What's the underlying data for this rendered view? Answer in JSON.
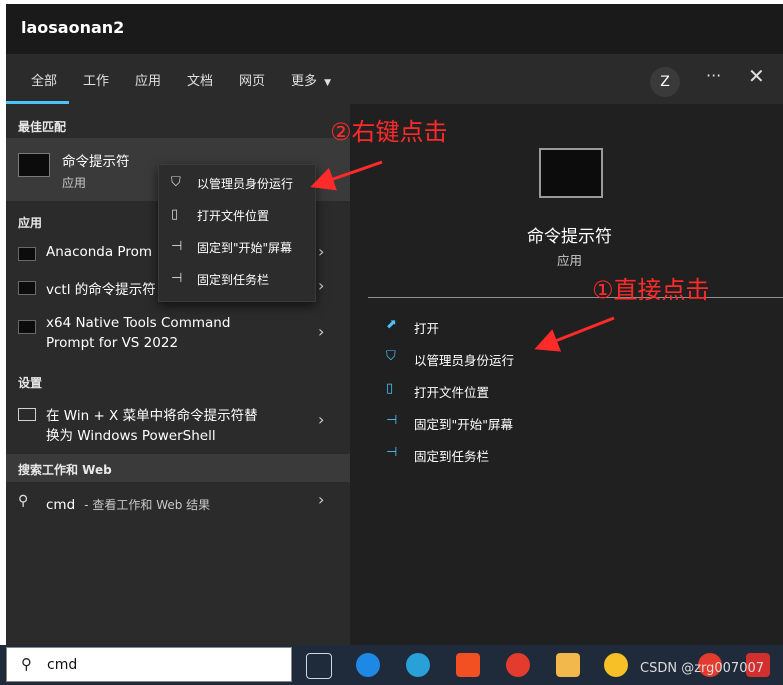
{
  "window": {
    "title": "laosaonan2"
  },
  "tabs": [
    {
      "label": "全部"
    },
    {
      "label": "工作"
    },
    {
      "label": "应用"
    },
    {
      "label": "文档"
    },
    {
      "label": "网页"
    },
    {
      "label": "更多"
    }
  ],
  "header": {
    "avatar_letter": "Z",
    "more_options_glyph": "···",
    "close_glyph": "✕"
  },
  "left": {
    "best_match": {
      "header": "最佳匹配",
      "name": "命令提示符",
      "subtitle": "应用"
    },
    "apps_header": "应用",
    "apps": [
      {
        "label": "Anaconda Prom"
      },
      {
        "label": "vctl 的命令提示符"
      },
      {
        "label": "x64 Native Tools Command",
        "label2": "Prompt for VS 2022"
      }
    ],
    "settings_header": "设置",
    "settings_item": {
      "line1": "在 Win + X 菜单中将命令提示符替",
      "line2": "换为 Windows PowerShell"
    },
    "search_web_header": "搜索工作和 Web",
    "search_web_item": {
      "query": "cmd",
      "suffix": "- 查看工作和 Web 结果"
    }
  },
  "context_menu": [
    {
      "label": "以管理员身份运行",
      "icon": "shield-icon"
    },
    {
      "label": "打开文件位置",
      "icon": "folder-icon"
    },
    {
      "label": "固定到\"开始\"屏幕",
      "icon": "pin-icon"
    },
    {
      "label": "固定到任务栏",
      "icon": "pin-icon"
    }
  ],
  "right": {
    "app_name": "命令提示符",
    "app_type": "应用",
    "actions": [
      {
        "label": "打开",
        "icon": "open-icon"
      },
      {
        "label": "以管理员身份运行",
        "icon": "shield-icon"
      },
      {
        "label": "打开文件位置",
        "icon": "folder-icon"
      },
      {
        "label": "固定到\"开始\"屏幕",
        "icon": "pin-icon"
      },
      {
        "label": "固定到任务栏",
        "icon": "pin-icon"
      }
    ]
  },
  "annotations": {
    "right_click": "②右键点击",
    "direct_click": "①直接点击"
  },
  "taskbar": {
    "search_value": "cmd",
    "watermark": "CSDN @zrg007007"
  },
  "colors": {
    "accent": "#4cc2ff",
    "annotation": "#ff2a2a"
  }
}
